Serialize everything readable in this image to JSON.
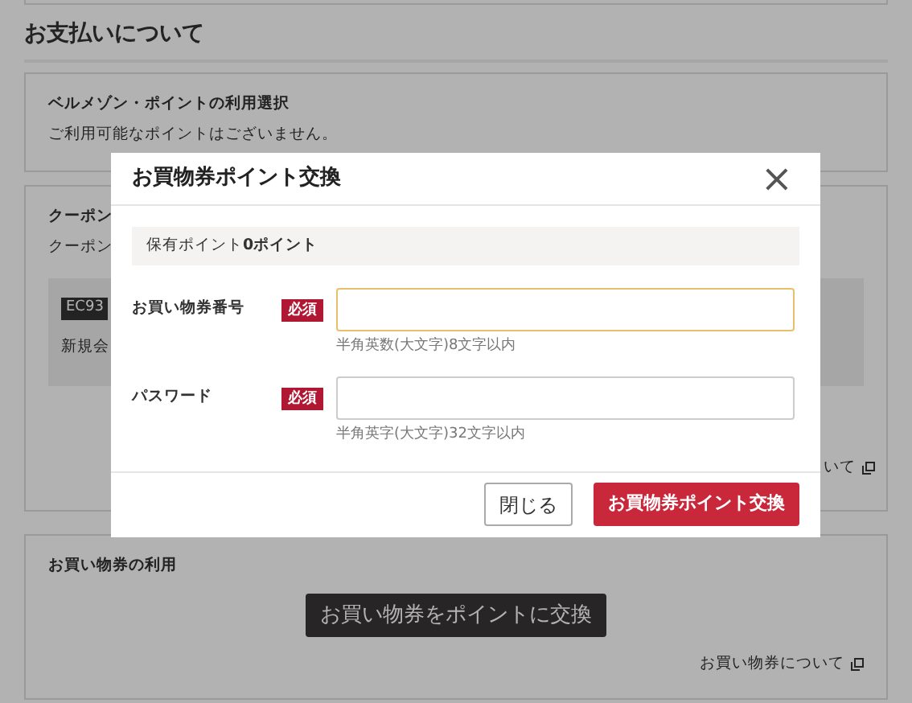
{
  "page": {
    "heading": "お支払いについて",
    "point_card": {
      "title": "ベルメゾン・ポイントの利用選択",
      "text": "ご利用可能なポイントはございません。"
    },
    "coupon_card": {
      "title": "クーポン",
      "text": "クーポン",
      "code": "EC93",
      "description": "新規会",
      "link": "いて"
    },
    "voucher_card": {
      "title": "お買い物券の利用",
      "button": "お買い物券をポイントに交換",
      "link": "お買い物券について"
    }
  },
  "modal": {
    "title": "お買物券ポイント交換",
    "close": "×",
    "held_points": "保有ポイント**0ポイント**",
    "fields": [
      {
        "label": "お買い物券番号",
        "required": "必須",
        "hint": "半角英数(大文字)8文字以内",
        "focused": true
      },
      {
        "label": "パスワード",
        "required": "必須",
        "hint": "半角英字(大文字)32文字以内",
        "focused": false
      }
    ],
    "buttons": [
      {
        "label": "閉じる",
        "kind": "secondary"
      },
      {
        "label": "お買物券ポイント交換",
        "kind": "primary"
      }
    ]
  }
}
